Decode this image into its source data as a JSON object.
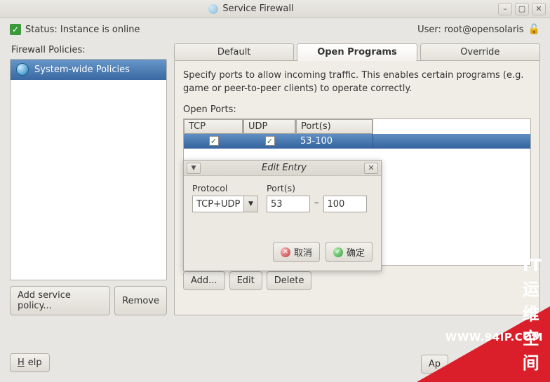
{
  "window": {
    "title": "Service Firewall"
  },
  "status": {
    "label": "Status: Instance is online",
    "user_label": "User: root@opensolaris"
  },
  "left": {
    "heading": "Firewall Policies:",
    "items": [
      {
        "label": "System-wide Policies"
      }
    ],
    "add_btn": "Add service policy...",
    "remove_btn": "Remove"
  },
  "tabs": {
    "default": "Default",
    "open_programs": "Open Programs",
    "override": "Override"
  },
  "panel": {
    "description": "Specify ports to allow incoming traffic. This enables certain programs (e.g. game or peer-to-peer clients) to operate correctly.",
    "open_ports_label": "Open Ports:",
    "columns": {
      "tcp": "TCP",
      "udp": "UDP",
      "ports": "Port(s)"
    },
    "row": {
      "tcp_checked": "✓",
      "udp_checked": "✓",
      "ports_value": "53-100"
    },
    "add_btn": "Add...",
    "edit_btn": "Edit",
    "delete_btn": "Delete"
  },
  "edit_popup": {
    "title": "Edit Entry",
    "protocol_label": "Protocol",
    "ports_label": "Port(s)",
    "protocol_value": "TCP+UDP",
    "port_from": "53",
    "port_to": "100",
    "dash": "–",
    "cancel": "取消",
    "ok": "确定"
  },
  "bottom": {
    "help": "Help",
    "apply_partial": "Ap"
  },
  "watermark": {
    "url": "WWW.94IP.COM",
    "text": "IT运维空间"
  }
}
